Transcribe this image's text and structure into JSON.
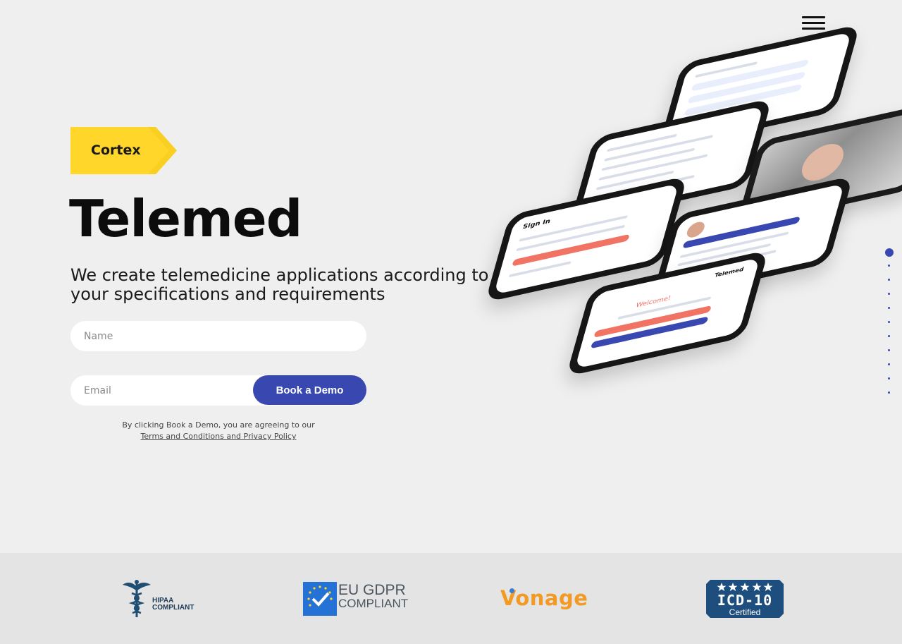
{
  "nav": {
    "menu_icon": "hamburger-menu-icon"
  },
  "brand": {
    "name": "Cortex",
    "badge_color": "#ffd629"
  },
  "hero": {
    "title": "Telemed",
    "subtitle": "We create telemedicine applications according to your specifications and requirements"
  },
  "form": {
    "name_placeholder": "Name",
    "email_placeholder": "Email",
    "submit_label": "Book a Demo",
    "legal_text": "By clicking Book a Demo, you are agreeing to our",
    "legal_link": "Terms and Conditions and Privacy Policy"
  },
  "phone_screens": {
    "signin_title": "Sign In",
    "welcome_title": "Welcome!",
    "app_logo": "Telemed"
  },
  "pagination": {
    "total": 11,
    "active_index": 0
  },
  "badges": [
    {
      "name": "HIPAA COMPLIANT",
      "line1": "HIPAA",
      "line2": "COMPLIANT",
      "icon": "caduceus-icon"
    },
    {
      "name": "EU GDPR COMPLIANT",
      "line1": "EU GDPR",
      "line2": "COMPLIANT",
      "icon": "gdpr-shield-icon"
    },
    {
      "name": "Vonage",
      "text": "Vonage",
      "icon": "vonage-logo"
    },
    {
      "name": "ICD-10 Certified",
      "line1": "ICD-10",
      "line2": "Certified",
      "icon": "stars-icon"
    }
  ],
  "colors": {
    "accent": "#3948b0",
    "badge": "#ffd629",
    "background": "#efefef",
    "footer": "#e4e4e4"
  }
}
